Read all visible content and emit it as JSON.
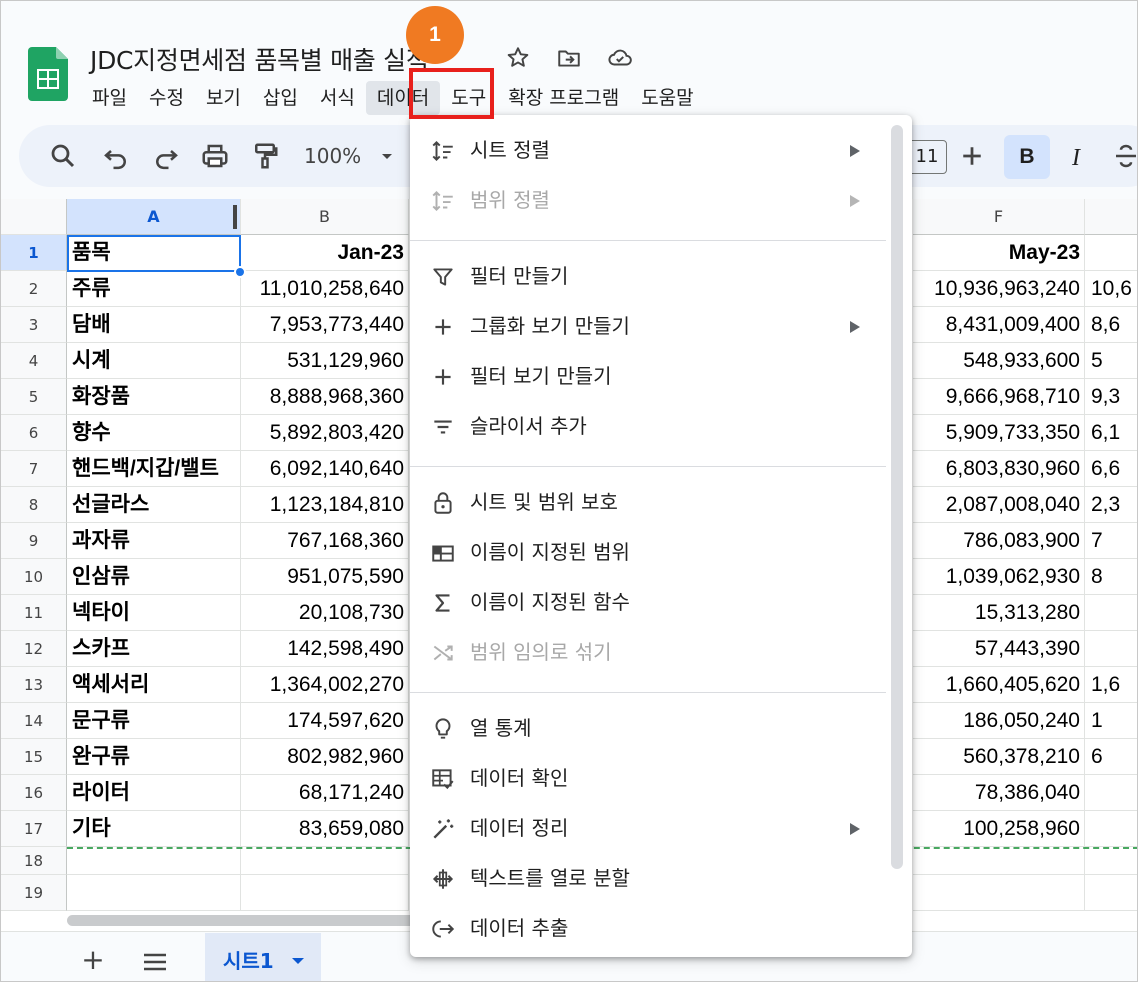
{
  "callout": {
    "number": "1"
  },
  "app": {
    "title": "JDC지정면세점 품목별 매출 실적",
    "menus": [
      "파일",
      "수정",
      "보기",
      "삽입",
      "서식",
      "데이터",
      "도구",
      "확장 프로그램",
      "도움말"
    ],
    "active_menu": "데이터"
  },
  "toolbar": {
    "zoom": "100%",
    "font_size": "11",
    "bold_label": "B",
    "italic_label": "I"
  },
  "grid": {
    "columns": [
      "A",
      "B",
      "F"
    ],
    "selected_column": "A",
    "rows": [
      {
        "num": "1",
        "a": "품목",
        "b": "Jan-23",
        "f": "May-23",
        "g": ""
      },
      {
        "num": "2",
        "a": "주류",
        "b": "11,010,258,640",
        "f": "10,936,963,240",
        "g": "10,6"
      },
      {
        "num": "3",
        "a": "담배",
        "b": "7,953,773,440",
        "f": "8,431,009,400",
        "g": "8,6"
      },
      {
        "num": "4",
        "a": "시계",
        "b": "531,129,960",
        "f": "548,933,600",
        "g": "5"
      },
      {
        "num": "5",
        "a": "화장품",
        "b": "8,888,968,360",
        "f": "9,666,968,710",
        "g": "9,3"
      },
      {
        "num": "6",
        "a": "향수",
        "b": "5,892,803,420",
        "f": "5,909,733,350",
        "g": "6,1"
      },
      {
        "num": "7",
        "a": "핸드백/지갑/밸트",
        "b": "6,092,140,640",
        "f": "6,803,830,960",
        "g": "6,6"
      },
      {
        "num": "8",
        "a": "선글라스",
        "b": "1,123,184,810",
        "f": "2,087,008,040",
        "g": "2,3"
      },
      {
        "num": "9",
        "a": "과자류",
        "b": "767,168,360",
        "f": "786,083,900",
        "g": "7"
      },
      {
        "num": "10",
        "a": "인삼류",
        "b": "951,075,590",
        "f": "1,039,062,930",
        "g": "8"
      },
      {
        "num": "11",
        "a": "넥타이",
        "b": "20,108,730",
        "f": "15,313,280",
        "g": ""
      },
      {
        "num": "12",
        "a": "스카프",
        "b": "142,598,490",
        "f": "57,443,390",
        "g": ""
      },
      {
        "num": "13",
        "a": "액세서리",
        "b": "1,364,002,270",
        "f": "1,660,405,620",
        "g": "1,6"
      },
      {
        "num": "14",
        "a": "문구류",
        "b": "174,597,620",
        "f": "186,050,240",
        "g": "1"
      },
      {
        "num": "15",
        "a": "완구류",
        "b": "802,982,960",
        "f": "560,378,210",
        "g": "6"
      },
      {
        "num": "16",
        "a": "라이터",
        "b": "68,171,240",
        "f": "78,386,040",
        "g": ""
      },
      {
        "num": "17",
        "a": "기타",
        "b": "83,659,080",
        "f": "100,258,960",
        "g": ""
      },
      {
        "num": "18",
        "a": "",
        "b": "",
        "f": "",
        "g": ""
      },
      {
        "num": "19",
        "a": "",
        "b": "",
        "f": "",
        "g": ""
      }
    ]
  },
  "sheets": {
    "active_tab": "시트1"
  },
  "data_menu": {
    "items": [
      {
        "label": "시트 정렬",
        "icon": "sort-icon",
        "submenu": true,
        "disabled": false
      },
      {
        "label": "범위 정렬",
        "icon": "sort-range-icon",
        "submenu": true,
        "disabled": true
      },
      {
        "label": "필터 만들기",
        "icon": "filter-icon",
        "submenu": false,
        "disabled": false
      },
      {
        "label": "그룹화 보기 만들기",
        "icon": "plus-icon",
        "submenu": true,
        "disabled": false
      },
      {
        "label": "필터 보기 만들기",
        "icon": "plus-icon",
        "submenu": false,
        "disabled": false
      },
      {
        "label": "슬라이서 추가",
        "icon": "slicer-icon",
        "submenu": false,
        "disabled": false
      },
      {
        "label": "시트 및 범위 보호",
        "icon": "lock-icon",
        "submenu": false,
        "disabled": false
      },
      {
        "label": "이름이 지정된 범위",
        "icon": "named-range-icon",
        "submenu": false,
        "disabled": false
      },
      {
        "label": "이름이 지정된 함수",
        "icon": "sigma-icon",
        "submenu": false,
        "disabled": false
      },
      {
        "label": "범위 임의로 섞기",
        "icon": "shuffle-icon",
        "submenu": false,
        "disabled": true
      },
      {
        "label": "열 통계",
        "icon": "lightbulb-icon",
        "submenu": false,
        "disabled": false
      },
      {
        "label": "데이터 확인",
        "icon": "data-validation-icon",
        "submenu": false,
        "disabled": false
      },
      {
        "label": "데이터 정리",
        "icon": "magic-wand-icon",
        "submenu": true,
        "disabled": false
      },
      {
        "label": "텍스트를 열로 분할",
        "icon": "split-columns-icon",
        "submenu": false,
        "disabled": false
      },
      {
        "label": "데이터 추출",
        "icon": "extract-icon",
        "submenu": false,
        "disabled": false
      }
    ]
  }
}
